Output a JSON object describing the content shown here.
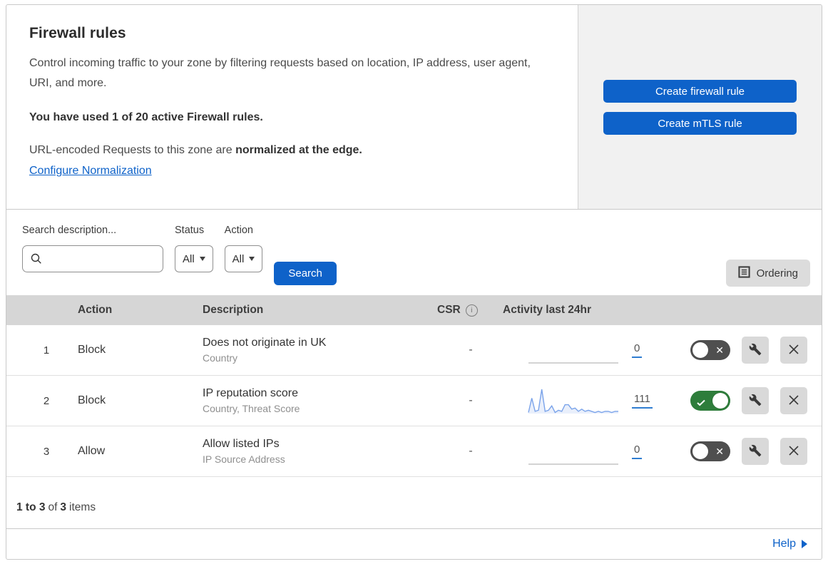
{
  "hero": {
    "title": "Firewall rules",
    "description": "Control incoming traffic to your zone by filtering requests based on location, IP address, user agent, URI, and more.",
    "usage": "You have used 1 of 20 active Firewall rules.",
    "normalization_prefix": "URL-encoded Requests to this zone are",
    "normalization_bold": "normalized at the edge.",
    "normalization_link": "Configure Normalization",
    "create_firewall_button": "Create firewall rule",
    "create_mtls_button": "Create mTLS rule"
  },
  "filters": {
    "search_label": "Search description...",
    "search_value": "",
    "status_label": "Status",
    "status_value": "All",
    "action_label": "Action",
    "action_value": "All",
    "search_button": "Search",
    "ordering_button": "Ordering"
  },
  "table": {
    "columns": {
      "action": "Action",
      "description": "Description",
      "csr": "CSR",
      "activity": "Activity last 24hr"
    },
    "rows": [
      {
        "position": "1",
        "action": "Block",
        "description": "Does not originate in UK",
        "expression_fields": "Country",
        "csr": "-",
        "activity_count": "0",
        "enabled": false,
        "activity_sparkline": []
      },
      {
        "position": "2",
        "action": "Block",
        "description": "IP reputation score",
        "expression_fields": "Country, Threat Score",
        "csr": "-",
        "activity_count": "111",
        "enabled": true,
        "activity_sparkline": [
          1,
          14,
          2,
          3,
          22,
          2,
          3,
          7,
          1,
          3,
          2,
          8,
          8,
          4,
          5,
          2,
          4,
          2,
          3,
          2,
          1,
          2,
          1,
          2,
          2,
          1,
          2,
          2
        ]
      },
      {
        "position": "3",
        "action": "Allow",
        "description": "Allow listed IPs",
        "expression_fields": "IP Source Address",
        "csr": "-",
        "activity_count": "0",
        "enabled": false,
        "activity_sparkline": []
      }
    ]
  },
  "pagination": {
    "range": "1 to 3",
    "of_label": "of",
    "total": "3",
    "items_label": "items"
  },
  "footer": {
    "help_label": "Help"
  },
  "colors": {
    "primary_blue": "#0e62c9",
    "toggle_on_green": "#2e7d3b",
    "toggle_off_gray": "#4f4f4f",
    "sparkline_line": "#7aa3ea",
    "sparkline_fill": "#e9effb",
    "table_header_bg": "#d6d6d6",
    "side_panel_bg": "#f1f1f1"
  }
}
